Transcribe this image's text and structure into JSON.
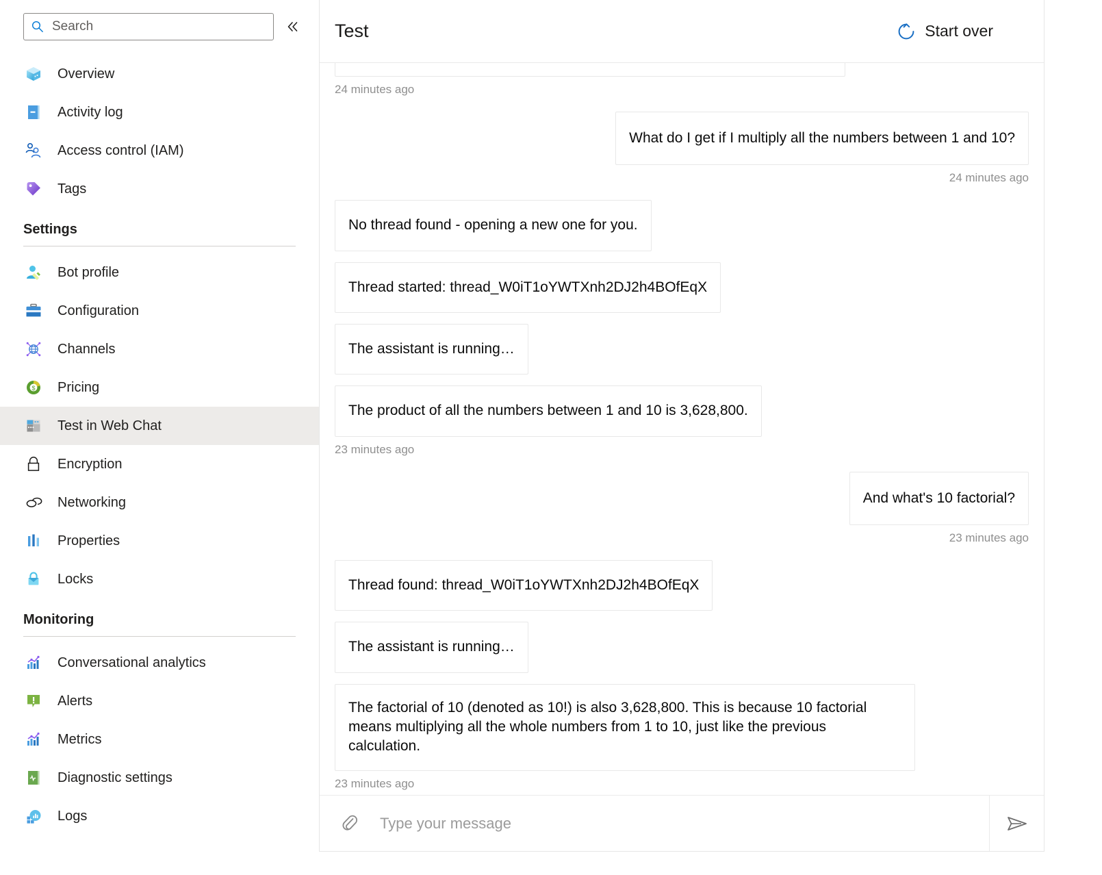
{
  "sidebar": {
    "search": {
      "placeholder": "Search",
      "value": "",
      "icon": "search-icon"
    },
    "collapse_label": "«",
    "top_items": [
      {
        "label": "Overview",
        "icon": "overview-cube-icon"
      },
      {
        "label": "Activity log",
        "icon": "activity-log-icon"
      },
      {
        "label": "Access control (IAM)",
        "icon": "access-control-people-icon"
      },
      {
        "label": "Tags",
        "icon": "tags-icon"
      }
    ],
    "groups": [
      {
        "title": "Settings",
        "items": [
          {
            "label": "Bot profile",
            "icon": "bot-profile-icon",
            "selected": false
          },
          {
            "label": "Configuration",
            "icon": "configuration-briefcase-icon",
            "selected": false
          },
          {
            "label": "Channels",
            "icon": "channels-globe-icon",
            "selected": false
          },
          {
            "label": "Pricing",
            "icon": "pricing-dollar-icon",
            "selected": false
          },
          {
            "label": "Test in Web Chat",
            "icon": "test-web-chat-icon",
            "selected": true
          },
          {
            "label": "Encryption",
            "icon": "encryption-lock-icon",
            "selected": false
          },
          {
            "label": "Networking",
            "icon": "networking-links-icon",
            "selected": false
          },
          {
            "label": "Properties",
            "icon": "properties-bars-icon",
            "selected": false
          },
          {
            "label": "Locks",
            "icon": "locks-padlock-icon",
            "selected": false
          }
        ]
      },
      {
        "title": "Monitoring",
        "items": [
          {
            "label": "Conversational analytics",
            "icon": "analytics-chart-icon",
            "selected": false
          },
          {
            "label": "Alerts",
            "icon": "alerts-icon",
            "selected": false
          },
          {
            "label": "Metrics",
            "icon": "metrics-chart-icon",
            "selected": false
          },
          {
            "label": "Diagnostic settings",
            "icon": "diagnostic-settings-icon",
            "selected": false
          },
          {
            "label": "Logs",
            "icon": "logs-icon",
            "selected": false
          }
        ]
      }
    ]
  },
  "chat": {
    "title": "Test",
    "start_over_label": "Start over",
    "start_over_icon": "refresh-circle-icon",
    "messages": [
      {
        "id": "clipped-top",
        "from": "bot",
        "text": "",
        "clipped": true
      },
      {
        "id": "ts-0",
        "kind": "timestamp",
        "align": "left",
        "text": "24 minutes ago"
      },
      {
        "id": "m1",
        "from": "user",
        "text": "What do I get if I multiply all the numbers between 1 and 10?"
      },
      {
        "id": "ts-1",
        "kind": "timestamp",
        "align": "right",
        "text": "24 minutes ago"
      },
      {
        "id": "m2",
        "from": "bot",
        "text": "No thread found - opening a new one for you."
      },
      {
        "id": "m3",
        "from": "bot",
        "text": "Thread started: thread_W0iT1oYWTXnh2DJ2h4BOfEqX"
      },
      {
        "id": "m4",
        "from": "bot",
        "text": "The assistant is running…"
      },
      {
        "id": "m5",
        "from": "bot",
        "text": "The product of all the numbers between 1 and 10 is 3,628,800."
      },
      {
        "id": "ts-2",
        "kind": "timestamp",
        "align": "left",
        "text": "23 minutes ago"
      },
      {
        "id": "m6",
        "from": "user",
        "text": "And what's 10 factorial?"
      },
      {
        "id": "ts-3",
        "kind": "timestamp",
        "align": "right",
        "text": "23 minutes ago"
      },
      {
        "id": "m7",
        "from": "bot",
        "text": "Thread found: thread_W0iT1oYWTXnh2DJ2h4BOfEqX"
      },
      {
        "id": "m8",
        "from": "bot",
        "text": "The assistant is running…"
      },
      {
        "id": "m9",
        "from": "bot",
        "text": "The factorial of 10 (denoted as 10!) is also 3,628,800. This is because 10 factorial means multiplying all the whole numbers from 1 to 10, just like the previous calculation."
      },
      {
        "id": "ts-4",
        "kind": "timestamp",
        "align": "left",
        "text": "23 minutes ago"
      }
    ],
    "composer": {
      "attach_icon": "paperclip-icon",
      "placeholder": "Type your message",
      "value": "",
      "send_icon": "send-paper-plane-icon"
    }
  },
  "colors": {
    "accent": "#0078d4",
    "selected_row": "#edebe9",
    "bubble_border": "#e8e8e8",
    "text": "#201f1e",
    "muted": "#8f8f8f"
  }
}
